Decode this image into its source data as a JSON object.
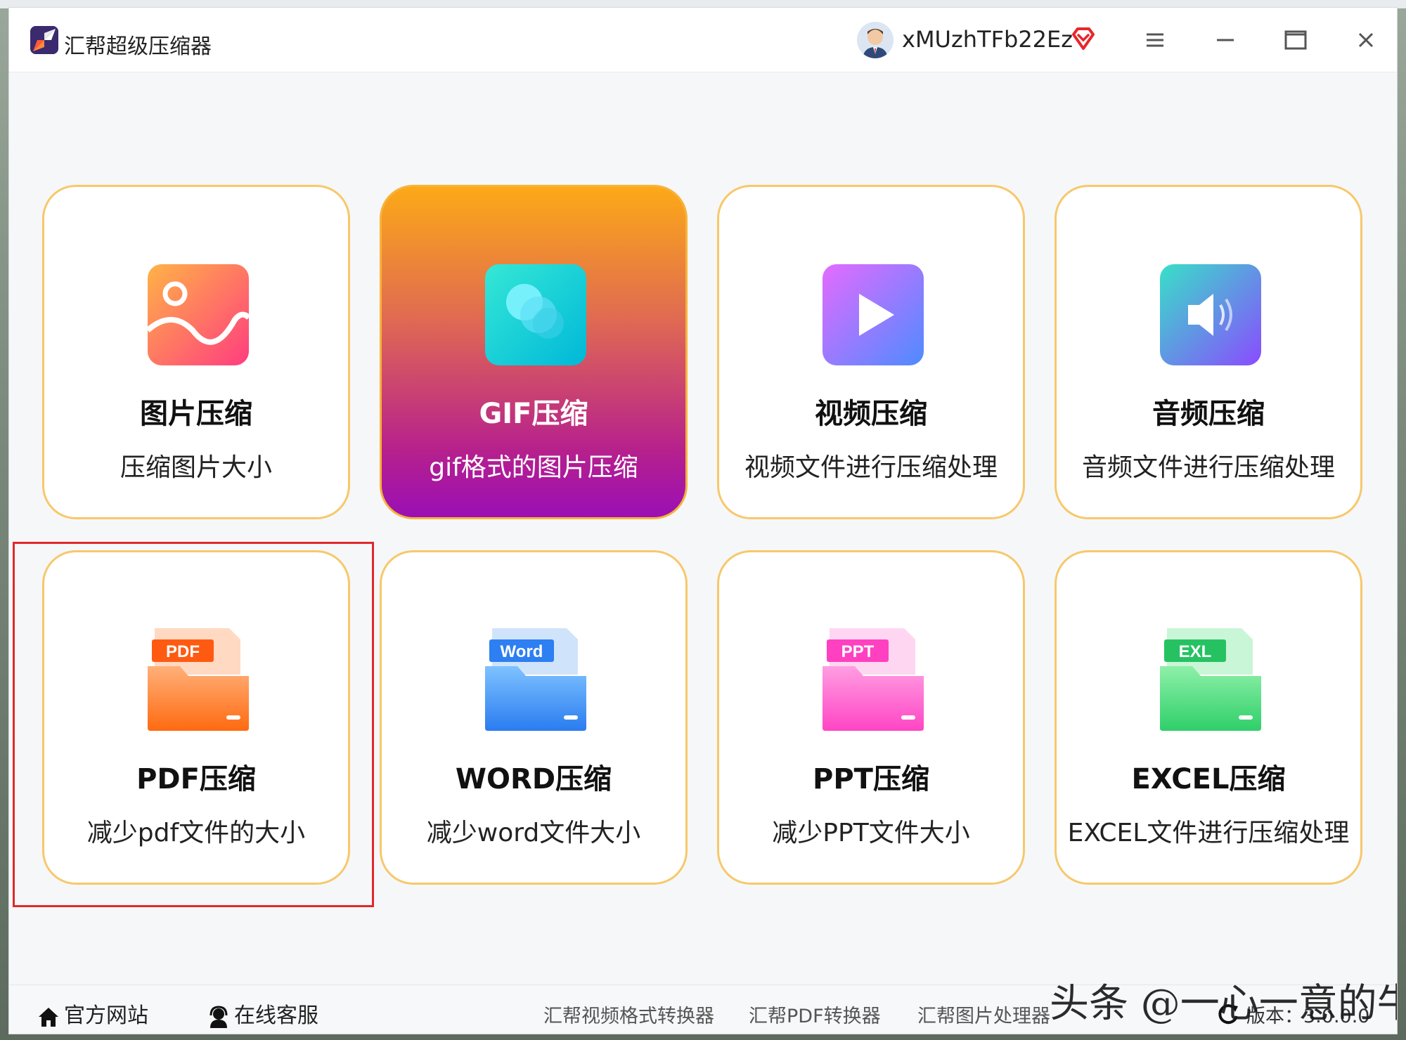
{
  "app": {
    "title": "汇帮超级压缩器"
  },
  "user": {
    "name": "xMUzhTFb22Ez"
  },
  "cards": [
    {
      "title": "图片压缩",
      "subtitle": "压缩图片大小"
    },
    {
      "title": "GIF压缩",
      "subtitle": "gif格式的图片压缩"
    },
    {
      "title": "视频压缩",
      "subtitle": "视频文件进行压缩处理"
    },
    {
      "title": "音频压缩",
      "subtitle": "音频文件进行压缩处理"
    },
    {
      "title": "PDF压缩",
      "subtitle": "减少pdf文件的大小",
      "badge": "PDF"
    },
    {
      "title": "WORD压缩",
      "subtitle": "减少word文件大小",
      "badge": "Word"
    },
    {
      "title": "PPT压缩",
      "subtitle": "减少PPT文件大小",
      "badge": "PPT"
    },
    {
      "title": "EXCEL压缩",
      "subtitle": "EXCEL文件进行压缩处理",
      "badge": "EXL"
    }
  ],
  "footer": {
    "website": "官方网站",
    "support": "在线客服",
    "links": [
      "汇帮视频格式转换器",
      "汇帮PDF转换器",
      "汇帮图片处理器"
    ],
    "version_label": "版本：",
    "version_value": "3.0.0.0"
  },
  "watermark": "头条 @一心一意的牛",
  "colors": {
    "card_border": "#f7c86a",
    "active_gradient_top": "#fca917",
    "active_gradient_bottom": "#9b0fb5",
    "highlight": "#e0292b"
  }
}
